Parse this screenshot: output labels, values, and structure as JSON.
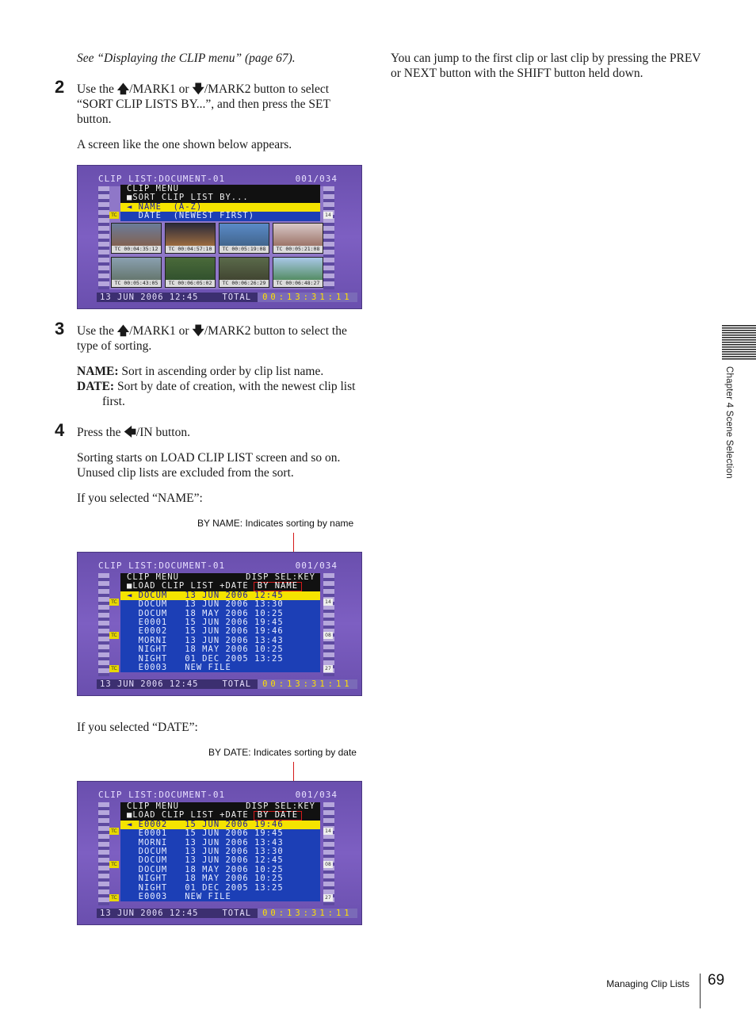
{
  "left_column": {
    "see_ref": "See “Displaying the CLIP menu” (page 67).",
    "steps": [
      {
        "number": "2",
        "text_a": "Use the ",
        "text_b": "/MARK1 or ",
        "text_c": "/MARK2 button to select “SORT CLIP LISTS BY...”, and then press the SET button.",
        "note": "A screen like the one shown below appears."
      },
      {
        "number": "3",
        "text_a": "Use the ",
        "text_b": "/MARK1 or ",
        "text_c": "/MARK2 button to select the type of sorting.",
        "defs": [
          {
            "term": "NAME:",
            "desc": " Sort in ascending order by clip list name."
          },
          {
            "term": "DATE:",
            "desc": " Sort by date of creation, with the newest clip list first."
          }
        ]
      },
      {
        "number": "4",
        "text_a": "Press the ",
        "text_b": "/IN button.",
        "note": "Sorting starts on LOAD CLIP LIST screen and so on. Unused clip lists are excluded from the sort."
      }
    ],
    "if_name": "If you selected “NAME”:",
    "if_date": "If you selected “DATE”:",
    "callout_name": "BY NAME: Indicates sorting by name",
    "callout_date": "BY DATE: Indicates sorting by date"
  },
  "icons": {
    "up": "up-arrow-icon",
    "down": "down-arrow-icon",
    "left": "left-arrow-icon"
  },
  "glyphs": {
    "up": "🡅",
    "down": "🡇",
    "left": "🡄"
  },
  "screen1": {
    "header_left": "CLIP LIST:DOCUMENT-01",
    "header_right": "001/034",
    "menu_title": "CLIP MENU",
    "menu_sub": "■SORT CLIP LIST BY...",
    "sel_row": "◄ NAME  (A-Z)",
    "item_row": "  DATE  (NEWEST FIRST)",
    "thumb_tcs": [
      "TC 00:04:35:12",
      "TC 00:04:57:10",
      "TC 00:05:19:08",
      "TC 00:05:21:08",
      "TC 00:05:43:05",
      "TC 00:06:05:02",
      "TC 00:06:26:29",
      "TC 00:06:48:27"
    ],
    "tag_tc": "TC",
    "tag_num": "14",
    "footer_date": "13 JUN 2006 12:45",
    "footer_total_label": "TOTAL",
    "footer_total_value": "00:13:31:11"
  },
  "screen2": {
    "header_left": "CLIP LIST:DOCUMENT-01",
    "header_right": "001/034",
    "menu_title": "CLIP MENU",
    "menu_title_right": "DISP SEL:KEY",
    "menu_sub": "■LOAD CLIP LIST +DATE",
    "sort_box": "BY NAME",
    "rows": [
      "◄ DOCUM   13 JUN 2006 12:45",
      "  DOCUM   13 JUN 2006 13:30",
      "  DOCUM   18 MAY 2006 10:25",
      "  E0001   15 JUN 2006 19:45",
      "  E0002   15 JUN 2006 19:46",
      "  MORNI   13 JUN 2006 13:43",
      "  NIGHT   18 MAY 2006 10:25",
      "  NIGHT   01 DEC 2005 13:25",
      "  E0003   NEW FILE"
    ],
    "tags": [
      "TC",
      "14",
      "TC",
      "08",
      "TC",
      "27"
    ],
    "footer_date": "13 JUN 2006 12:45",
    "footer_total_label": "TOTAL",
    "footer_total_value": "00:13:31:11"
  },
  "screen3": {
    "header_left": "CLIP LIST:DOCUMENT-01",
    "header_right": "001/034",
    "menu_title": "CLIP MENU",
    "menu_title_right": "DISP SEL:KEY",
    "menu_sub": "■LOAD CLIP LIST +DATE",
    "sort_box": "BY DATE",
    "rows": [
      "◄ E0002   15 JUN 2006 19:46",
      "  E0001   15 JUN 2006 19:45",
      "  MORNI   13 JUN 2006 13:43",
      "  DOCUM   13 JUN 2006 13:30",
      "  DOCUM   13 JUN 2006 12:45",
      "  DOCUM   18 MAY 2006 10:25",
      "  NIGHT   18 MAY 2006 10:25",
      "  NIGHT   01 DEC 2005 13:25",
      "  E0003   NEW FILE"
    ],
    "tags": [
      "TC",
      "14",
      "TC",
      "08",
      "TC",
      "27"
    ],
    "footer_date": "13 JUN 2006 12:45",
    "footer_total_label": "TOTAL",
    "footer_total_value": "00:13:31:11"
  },
  "right_column": {
    "text": "You can jump to the first clip or last clip by pressing the PREV or NEXT button with the SHIFT button held down."
  },
  "side": {
    "chapter": "Chapter 4  Scene Selection"
  },
  "footer": {
    "section": "Managing Clip Lists",
    "page": "69"
  }
}
